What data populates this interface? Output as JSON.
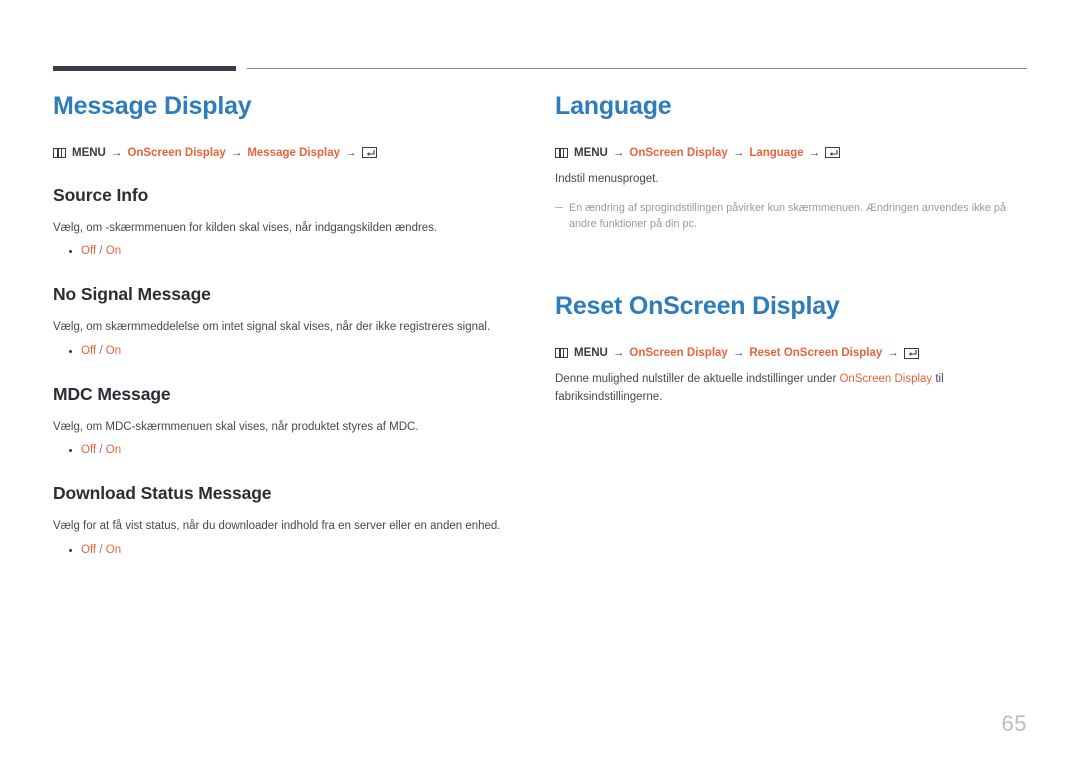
{
  "page": {
    "number": "65",
    "accent_blue": "#2d7cbb",
    "accent_orange": "#e8643c",
    "heading_dark": "#2f2b36",
    "rule_dark": "#3f3b4d",
    "rule_light": "#8b8b91",
    "note_gray": "#9a99a3",
    "page_number_gray": "#b9bcc8"
  },
  "icons": {
    "menu": "menu-grid-icon",
    "enter": "enter-key-icon"
  },
  "left_column": {
    "title": "Message Display",
    "breadcrumb": {
      "menu_label": "MENU",
      "arrow": "→",
      "step1": "OnScreen Display",
      "step2": "Message Display"
    },
    "sections": [
      {
        "heading": "Source Info",
        "body": "Vælg, om -skærmmenuen for kilden skal vises, når indgangskilden ændres.",
        "options": {
          "first": "Off",
          "separator": "/",
          "second": "On"
        }
      },
      {
        "heading": "No Signal Message",
        "body": "Vælg, om skærmmeddelelse om intet signal skal vises, når der ikke registreres signal.",
        "options": {
          "first": "Off",
          "separator": "/",
          "second": "On"
        }
      },
      {
        "heading": "MDC Message",
        "body": "Vælg, om MDC-skærmmenuen skal vises, når produktet styres af MDC.",
        "options": {
          "first": "Off",
          "separator": "/",
          "second": "On"
        }
      },
      {
        "heading": "Download Status Message",
        "body": "Vælg for at få vist status, når du downloader indhold fra en server eller en anden enhed.",
        "options": {
          "first": "Off",
          "separator": "/",
          "second": "On"
        }
      }
    ]
  },
  "right_column": {
    "language": {
      "title": "Language",
      "breadcrumb": {
        "menu_label": "MENU",
        "arrow": "→",
        "step1": "OnScreen Display",
        "step2": "Language"
      },
      "body": "Indstil menusproget.",
      "note": "En ændring af sprogindstillingen påvirker kun skærmmenuen. Ændringen anvendes ikke på andre funktioner på din pc."
    },
    "reset": {
      "title": "Reset OnScreen Display",
      "breadcrumb": {
        "menu_label": "MENU",
        "arrow": "→",
        "step1": "OnScreen Display",
        "step2": "Reset OnScreen Display"
      },
      "body_before": "Denne mulighed nulstiller de aktuelle indstillinger under ",
      "body_link": "OnScreen Display",
      "body_after": " til fabriksindstillingerne."
    }
  }
}
